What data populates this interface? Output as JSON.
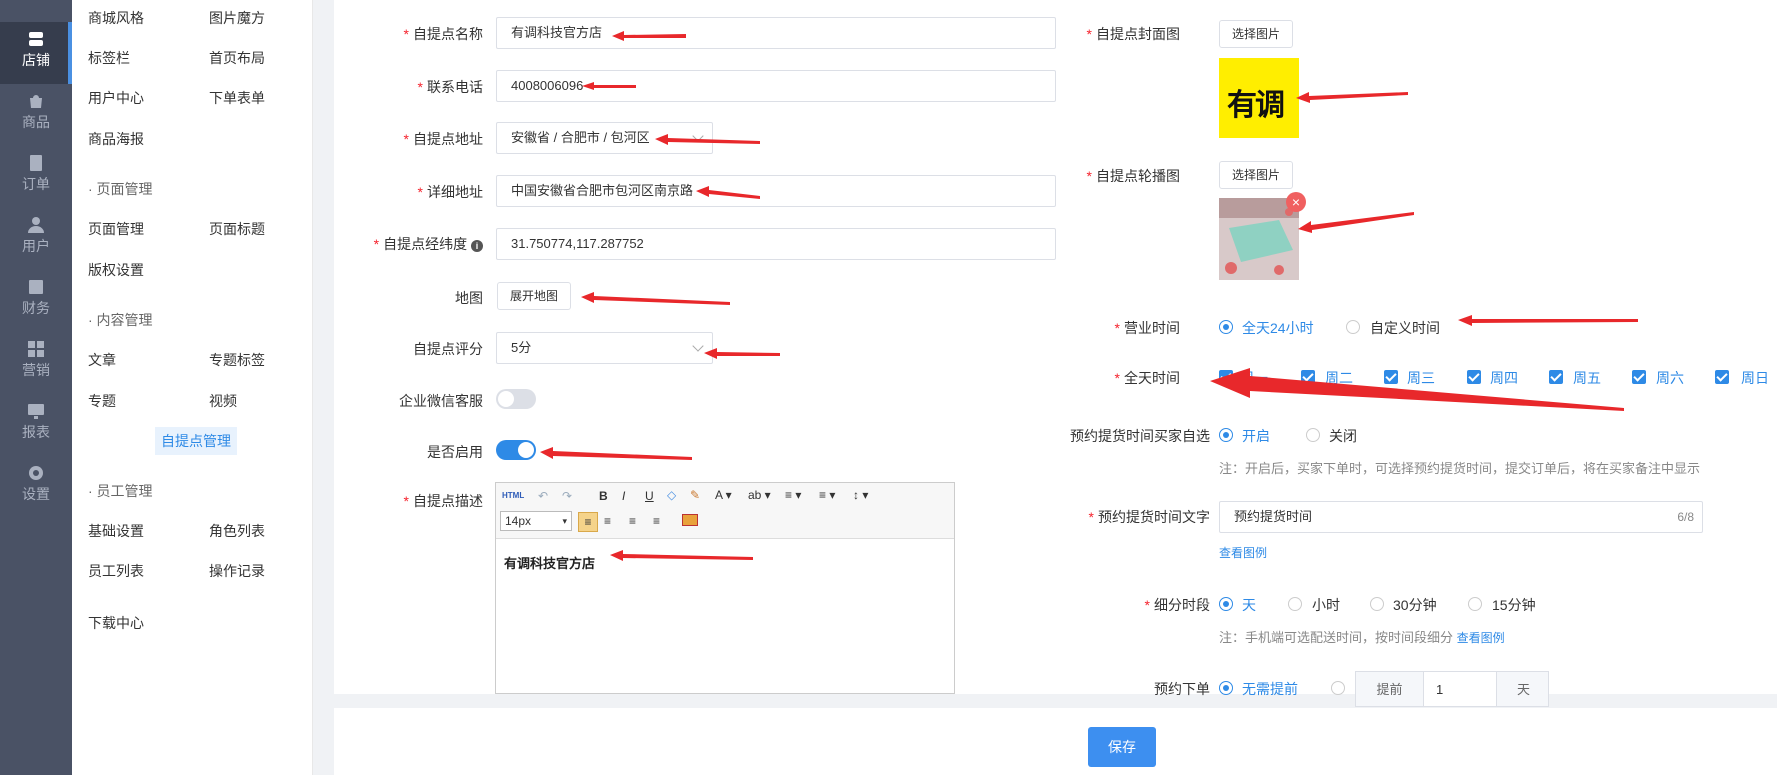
{
  "nav": {
    "items": [
      {
        "label": "店铺",
        "icon": "store-icon"
      },
      {
        "label": "商品",
        "icon": "bag-icon"
      },
      {
        "label": "订单",
        "icon": "order-icon"
      },
      {
        "label": "用户",
        "icon": "user-icon"
      },
      {
        "label": "财务",
        "icon": "finance-icon"
      },
      {
        "label": "营销",
        "icon": "marketing-icon"
      },
      {
        "label": "报表",
        "icon": "report-icon"
      },
      {
        "label": "设置",
        "icon": "gear-icon"
      }
    ]
  },
  "submenu": {
    "row1": [
      "商城风格",
      "图片魔方"
    ],
    "row2": [
      "标签栏",
      "首页布局"
    ],
    "row3": [
      "用户中心",
      "下单表单"
    ],
    "row4": [
      "商品海报"
    ],
    "group_page": "· 页面管理",
    "row5": [
      "页面管理",
      "页面标题"
    ],
    "row6": [
      "版权设置"
    ],
    "group_content": "· 内容管理",
    "row7": [
      "文章",
      "专题标签"
    ],
    "row8": [
      "专题",
      "视频"
    ],
    "row9": [
      "自提点管理"
    ],
    "group_staff": "· 员工管理",
    "row10": [
      "基础设置",
      "角色列表"
    ],
    "row11": [
      "员工列表",
      "操作记录"
    ],
    "row12": [
      "下载中心"
    ]
  },
  "form": {
    "name_label": "自提点名称",
    "name_value": "有调科技官方店",
    "phone_label": "联系电话",
    "phone_value": "4008006096",
    "address_label": "自提点地址",
    "address_value": "安徽省 / 合肥市 / 包河区",
    "detail_label": "详细地址",
    "detail_value": "中国安徽省合肥市包河区南京路",
    "coord_label": "自提点经纬度",
    "coord_value": "31.750774,117.287752",
    "map_label": "地图",
    "map_button": "展开地图",
    "score_label": "自提点评分",
    "score_value": "5分",
    "wechat_label": "企业微信客服",
    "wechat_on": false,
    "enable_label": "是否启用",
    "enable_on": true,
    "desc_label": "自提点描述",
    "editor_font_size": "14px",
    "editor_content": "有调科技官方店"
  },
  "right": {
    "cover_label": "自提点封面图",
    "cover_button": "选择图片",
    "cover_logo_text": "有调",
    "carousel_label": "自提点轮播图",
    "carousel_button": "选择图片",
    "hours_label": "营业时间",
    "hours_options": [
      "全天24小时",
      "自定义时间"
    ],
    "allday_label": "全天时间",
    "days": [
      "周一",
      "周二",
      "周三",
      "周四",
      "周五",
      "周六",
      "周日"
    ],
    "pickup_self_label": "预约提货时间买家自选",
    "pickup_self_options": [
      "开启",
      "关闭"
    ],
    "pickup_note": "注：开启后，买家下单时，可选择预约提货时间，提交订单后，将在买家备注中显示",
    "pickup_text_label": "预约提货时间文字",
    "pickup_text_value": "预约提货时间",
    "pickup_text_count": "6/8",
    "view_example": "查看图例",
    "slot_label": "细分时段",
    "slot_options": [
      "天",
      "小时",
      "30分钟",
      "15分钟"
    ],
    "slot_note": "注：手机端可选配送时间，按时间段细分",
    "slot_view_example": "查看图例",
    "advance_label": "预约下单",
    "advance_options": [
      "无需提前"
    ],
    "advance_prefix": "提前",
    "advance_value": "1",
    "advance_unit": "天"
  },
  "footer": {
    "save_label": "保存"
  },
  "colors": {
    "accent": "#2e8ae6",
    "nav_bg": "#4a5265",
    "arrow": "#e8282b"
  }
}
